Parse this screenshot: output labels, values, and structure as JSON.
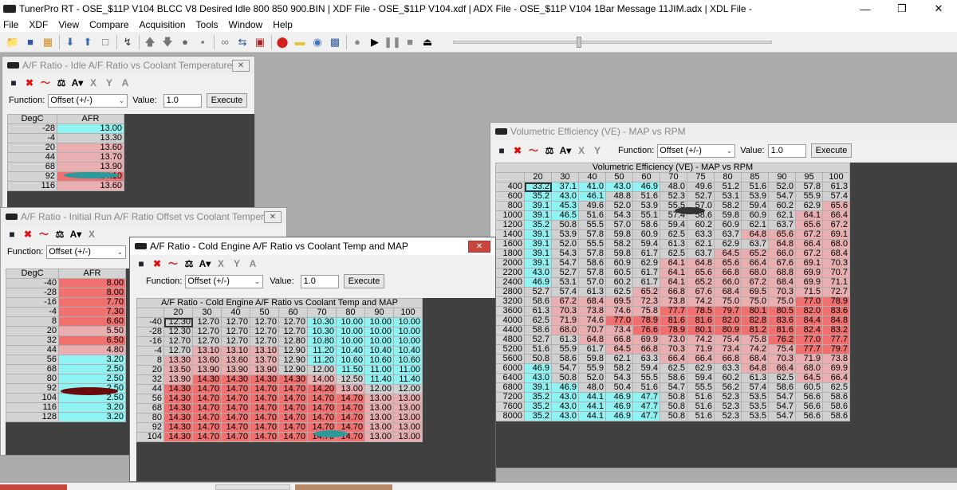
{
  "app": {
    "title": "TunerPro RT - OSE_$11P V104 BLCC V8 Desired Idle 800 850 900.BIN | XDF File - OSE_$11P V104.xdf | ADX File - OSE_$11P V104 1Bar Message 11JIM.adx | XDL File -"
  },
  "menu": [
    "File",
    "XDF",
    "View",
    "Compare",
    "Acquisition",
    "Tools",
    "Window",
    "Help"
  ],
  "toolbar_icons": [
    "open-folder-icon",
    "save-icon",
    "open-icon",
    "import-icon",
    "export-icon",
    "new-icon",
    "wand-icon",
    "upload-icon",
    "download-icon",
    "record-icon",
    "disk-icon",
    "link-icon",
    "swap-icon",
    "chip-icon",
    "stop-red-icon",
    "folder-yellow-icon",
    "emulator-icon",
    "gauge-icon",
    "dot-icon",
    "play-icon",
    "pause-icon",
    "stop-icon",
    "eject-icon"
  ],
  "function_label": "Function:",
  "value_label": "Value:",
  "execute_label": "Execute",
  "function_value": "Offset (+/-)",
  "value_value": "1.0",
  "colors": {
    "teal": "#8ff3f3",
    "red": "#f07070",
    "pink": "#e8aeb0",
    "gray": "#d0d0d0",
    "accent": "#c8473d"
  },
  "win1": {
    "title": "A/F Ratio - Idle A/F Ratio vs Coolant Temperature",
    "col_hdr": [
      "DegC",
      "AFR"
    ],
    "rows": [
      [
        "-28",
        "13.00"
      ],
      [
        "-4",
        "13.30"
      ],
      [
        "20",
        "13.60"
      ],
      [
        "44",
        "13.70"
      ],
      [
        "68",
        "13.90"
      ],
      [
        "92",
        "14.10"
      ],
      [
        "116",
        "13.60"
      ]
    ],
    "colors": [
      "teal",
      "gray",
      "pink",
      "pink",
      "pink",
      "red",
      "pink"
    ]
  },
  "win2": {
    "title": "A/F Ratio - Initial Run A/F Ratio Offset vs Coolant Temper...",
    "col_hdr": [
      "DegC",
      "AFR"
    ],
    "rows": [
      [
        "-40",
        "8.00"
      ],
      [
        "-28",
        "8.00"
      ],
      [
        "-16",
        "7.70"
      ],
      [
        "-4",
        "7.30"
      ],
      [
        "8",
        "6.60"
      ],
      [
        "20",
        "5.50"
      ],
      [
        "32",
        "6.50"
      ],
      [
        "44",
        "4.80"
      ],
      [
        "56",
        "3.20"
      ],
      [
        "68",
        "2.50"
      ],
      [
        "80",
        "2.50"
      ],
      [
        "92",
        "2.50"
      ],
      [
        "104",
        "2.50"
      ],
      [
        "116",
        "3.20"
      ],
      [
        "128",
        "3.20"
      ]
    ],
    "colors": [
      "red",
      "red",
      "red",
      "red",
      "red",
      "pink",
      "red",
      "pink",
      "teal",
      "teal",
      "teal",
      "teal",
      "teal",
      "teal",
      "teal"
    ]
  },
  "win3": {
    "title": "A/F Ratio - Cold Engine A/F Ratio vs Coolant Temp and MAP",
    "table_title": "A/F Ratio - Cold Engine A/F Ratio vs Coolant Temp and MAP",
    "cols": [
      "20",
      "30",
      "40",
      "50",
      "60",
      "70",
      "80",
      "90",
      "100"
    ],
    "rows": [
      {
        "h": "-40",
        "v": [
          "12.30",
          "12.70",
          "12.70",
          "12.70",
          "12.70",
          "10.30",
          "10.00",
          "10.00",
          "10.00"
        ]
      },
      {
        "h": "-28",
        "v": [
          "12.30",
          "12.70",
          "12.70",
          "12.70",
          "12.70",
          "10.30",
          "10.00",
          "10.00",
          "10.00"
        ]
      },
      {
        "h": "-16",
        "v": [
          "12.70",
          "12.70",
          "12.70",
          "12.70",
          "12.80",
          "10.80",
          "10.00",
          "10.00",
          "10.00"
        ]
      },
      {
        "h": "-4",
        "v": [
          "12.70",
          "13.10",
          "13.10",
          "13.10",
          "12.90",
          "11.20",
          "10.40",
          "10.40",
          "10.40"
        ]
      },
      {
        "h": "8",
        "v": [
          "13.30",
          "13.60",
          "13.60",
          "13.70",
          "12.90",
          "11.20",
          "10.60",
          "10.60",
          "10.60"
        ]
      },
      {
        "h": "20",
        "v": [
          "13.50",
          "13.90",
          "13.90",
          "13.90",
          "12.90",
          "12.00",
          "11.50",
          "11.00",
          "11.00"
        ]
      },
      {
        "h": "32",
        "v": [
          "13.90",
          "14.30",
          "14.30",
          "14.30",
          "14.30",
          "14.00",
          "12.50",
          "11.40",
          "11.40"
        ]
      },
      {
        "h": "44",
        "v": [
          "14.30",
          "14.70",
          "14.70",
          "14.70",
          "14.70",
          "14.20",
          "13.00",
          "12.00",
          "12.00"
        ]
      },
      {
        "h": "56",
        "v": [
          "14.30",
          "14.70",
          "14.70",
          "14.70",
          "14.70",
          "14.70",
          "14.70",
          "13.00",
          "13.00"
        ]
      },
      {
        "h": "68",
        "v": [
          "14.30",
          "14.70",
          "14.70",
          "14.70",
          "14.70",
          "14.70",
          "14.70",
          "13.00",
          "13.00"
        ]
      },
      {
        "h": "80",
        "v": [
          "14.30",
          "14.70",
          "14.70",
          "14.70",
          "14.70",
          "14.70",
          "14.70",
          "13.00",
          "13.00"
        ]
      },
      {
        "h": "92",
        "v": [
          "14.30",
          "14.70",
          "14.70",
          "14.70",
          "14.70",
          "14.70",
          "14.70",
          "13.00",
          "13.00"
        ]
      },
      {
        "h": "104",
        "v": [
          "14.30",
          "14.70",
          "14.70",
          "14.70",
          "14.70",
          "14.70",
          "14.70",
          "13.00",
          "13.00"
        ]
      }
    ]
  },
  "win4": {
    "title": "Volumetric Efficiency (VE) - MAP vs RPM",
    "table_title": "Volumetric Efficiency (VE) - MAP vs RPM",
    "cols": [
      "20",
      "30",
      "40",
      "50",
      "60",
      "70",
      "75",
      "80",
      "85",
      "90",
      "95",
      "100"
    ],
    "rows": [
      {
        "h": "400",
        "v": [
          "33.2",
          "37.1",
          "41.0",
          "43.0",
          "46.9",
          "48.0",
          "49.6",
          "51.2",
          "51.6",
          "52.0",
          "57.8",
          "61.3"
        ]
      },
      {
        "h": "600",
        "v": [
          "35.2",
          "43.0",
          "46.1",
          "48.8",
          "51.6",
          "52.3",
          "52.7",
          "53.1",
          "53.9",
          "54.7",
          "55.9",
          "57.4"
        ]
      },
      {
        "h": "800",
        "v": [
          "39.1",
          "45.3",
          "49.6",
          "52.0",
          "53.9",
          "55.5",
          "57.0",
          "58.2",
          "59.4",
          "60.2",
          "62.9",
          "65.6"
        ]
      },
      {
        "h": "1000",
        "v": [
          "39.1",
          "46.5",
          "51.6",
          "54.3",
          "55.1",
          "57.4",
          "58.6",
          "59.8",
          "60.9",
          "62.1",
          "64.1",
          "66.4"
        ]
      },
      {
        "h": "1200",
        "v": [
          "35.2",
          "50.8",
          "55.5",
          "57.0",
          "58.6",
          "59.4",
          "60.2",
          "60.9",
          "62.1",
          "63.7",
          "65.6",
          "67.2"
        ]
      },
      {
        "h": "1400",
        "v": [
          "39.1",
          "53.9",
          "57.8",
          "59.8",
          "60.9",
          "62.5",
          "63.3",
          "63.7",
          "64.8",
          "65.6",
          "67.2",
          "69.1"
        ]
      },
      {
        "h": "1600",
        "v": [
          "39.1",
          "52.0",
          "55.5",
          "58.2",
          "59.4",
          "61.3",
          "62.1",
          "62.9",
          "63.7",
          "64.8",
          "66.4",
          "68.0"
        ]
      },
      {
        "h": "1800",
        "v": [
          "39.1",
          "54.3",
          "57.8",
          "59.8",
          "61.7",
          "62.5",
          "63.7",
          "64.5",
          "65.2",
          "66.0",
          "67.2",
          "68.4"
        ]
      },
      {
        "h": "2000",
        "v": [
          "39.1",
          "54.7",
          "58.6",
          "60.9",
          "62.9",
          "64.1",
          "64.8",
          "65.6",
          "66.4",
          "67.6",
          "69.1",
          "70.3"
        ]
      },
      {
        "h": "2200",
        "v": [
          "43.0",
          "52.7",
          "57.8",
          "60.5",
          "61.7",
          "64.1",
          "65.6",
          "66.8",
          "68.0",
          "68.8",
          "69.9",
          "70.7"
        ]
      },
      {
        "h": "2400",
        "v": [
          "46.9",
          "53.1",
          "57.0",
          "60.2",
          "61.7",
          "64.1",
          "65.2",
          "66.0",
          "67.2",
          "68.4",
          "69.9",
          "71.1"
        ]
      },
      {
        "h": "2800",
        "v": [
          "52.7",
          "57.4",
          "61.3",
          "62.5",
          "65.2",
          "66.8",
          "67.6",
          "68.4",
          "69.5",
          "70.3",
          "71.5",
          "72.7"
        ]
      },
      {
        "h": "3200",
        "v": [
          "58.6",
          "67.2",
          "68.4",
          "69.5",
          "72.3",
          "73.8",
          "74.2",
          "75.0",
          "75.0",
          "75.0",
          "77.0",
          "78.9"
        ]
      },
      {
        "h": "3600",
        "v": [
          "61.3",
          "70.3",
          "73.8",
          "74.6",
          "75.8",
          "77.7",
          "78.5",
          "79.7",
          "80.1",
          "80.5",
          "82.0",
          "83.6"
        ]
      },
      {
        "h": "4000",
        "v": [
          "62.5",
          "71.9",
          "74.6",
          "77.0",
          "78.9",
          "81.6",
          "81.6",
          "82.0",
          "82.8",
          "83.6",
          "84.4",
          "84.8"
        ]
      },
      {
        "h": "4400",
        "v": [
          "58.6",
          "68.0",
          "70.7",
          "73.4",
          "76.6",
          "78.9",
          "80.1",
          "80.9",
          "81.2",
          "81.6",
          "82.4",
          "83.2"
        ]
      },
      {
        "h": "4800",
        "v": [
          "52.7",
          "61.3",
          "64.8",
          "66.8",
          "69.9",
          "73.0",
          "74.2",
          "75.4",
          "75.8",
          "76.2",
          "77.0",
          "77.7"
        ]
      },
      {
        "h": "5200",
        "v": [
          "51.6",
          "55.9",
          "61.7",
          "64.5",
          "66.8",
          "70.3",
          "71.9",
          "73.4",
          "74.2",
          "75.4",
          "77.7",
          "79.7"
        ]
      },
      {
        "h": "5600",
        "v": [
          "50.8",
          "58.6",
          "59.8",
          "62.1",
          "63.3",
          "66.4",
          "66.4",
          "66.8",
          "68.4",
          "70.3",
          "71.9",
          "73.8"
        ]
      },
      {
        "h": "6000",
        "v": [
          "46.9",
          "54.7",
          "55.9",
          "58.2",
          "59.4",
          "62.5",
          "62.9",
          "63.3",
          "64.8",
          "66.4",
          "68.0",
          "69.9"
        ]
      },
      {
        "h": "6400",
        "v": [
          "43.0",
          "50.8",
          "52.0",
          "54.3",
          "55.5",
          "58.6",
          "59.4",
          "60.2",
          "61.3",
          "62.5",
          "64.5",
          "66.4"
        ]
      },
      {
        "h": "6800",
        "v": [
          "39.1",
          "46.9",
          "48.0",
          "50.4",
          "51.6",
          "54.7",
          "55.5",
          "56.2",
          "57.4",
          "58.6",
          "60.5",
          "62.5"
        ]
      },
      {
        "h": "7200",
        "v": [
          "35.2",
          "43.0",
          "44.1",
          "46.9",
          "47.7",
          "50.8",
          "51.6",
          "52.3",
          "53.5",
          "54.7",
          "56.6",
          "58.6"
        ]
      },
      {
        "h": "7600",
        "v": [
          "35.2",
          "43.0",
          "44.1",
          "46.9",
          "47.7",
          "50.8",
          "51.6",
          "52.3",
          "53.5",
          "54.7",
          "56.6",
          "58.6"
        ]
      },
      {
        "h": "8000",
        "v": [
          "35.2",
          "43.0",
          "44.1",
          "46.9",
          "47.7",
          "50.8",
          "51.6",
          "52.3",
          "53.5",
          "54.7",
          "56.6",
          "58.6"
        ]
      }
    ]
  }
}
